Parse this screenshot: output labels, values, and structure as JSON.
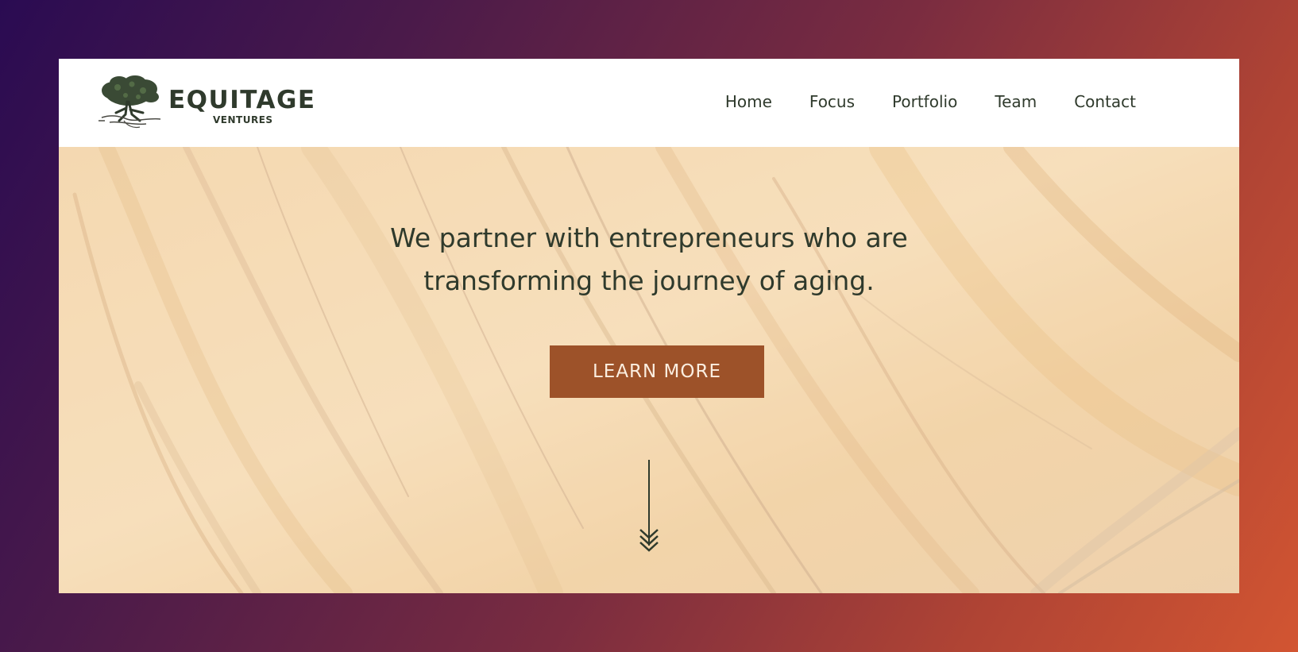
{
  "brand": {
    "name": "EQUITAGE",
    "sub": "VENTURES",
    "logo_icon": "tree-logo-icon"
  },
  "nav": {
    "items": [
      {
        "label": "Home"
      },
      {
        "label": "Focus"
      },
      {
        "label": "Portfolio"
      },
      {
        "label": "Team"
      },
      {
        "label": "Contact"
      }
    ]
  },
  "hero": {
    "headline_line1": "We partner with entrepreneurs who are",
    "headline_line2": "transforming the journey of aging.",
    "cta_label": "LEARN MORE",
    "scroll_icon": "down-arrow-icon"
  },
  "colors": {
    "text": "#2f3a2c",
    "cta_background": "#9d5229",
    "cta_text": "#fbeee0",
    "header_background": "#ffffff"
  }
}
